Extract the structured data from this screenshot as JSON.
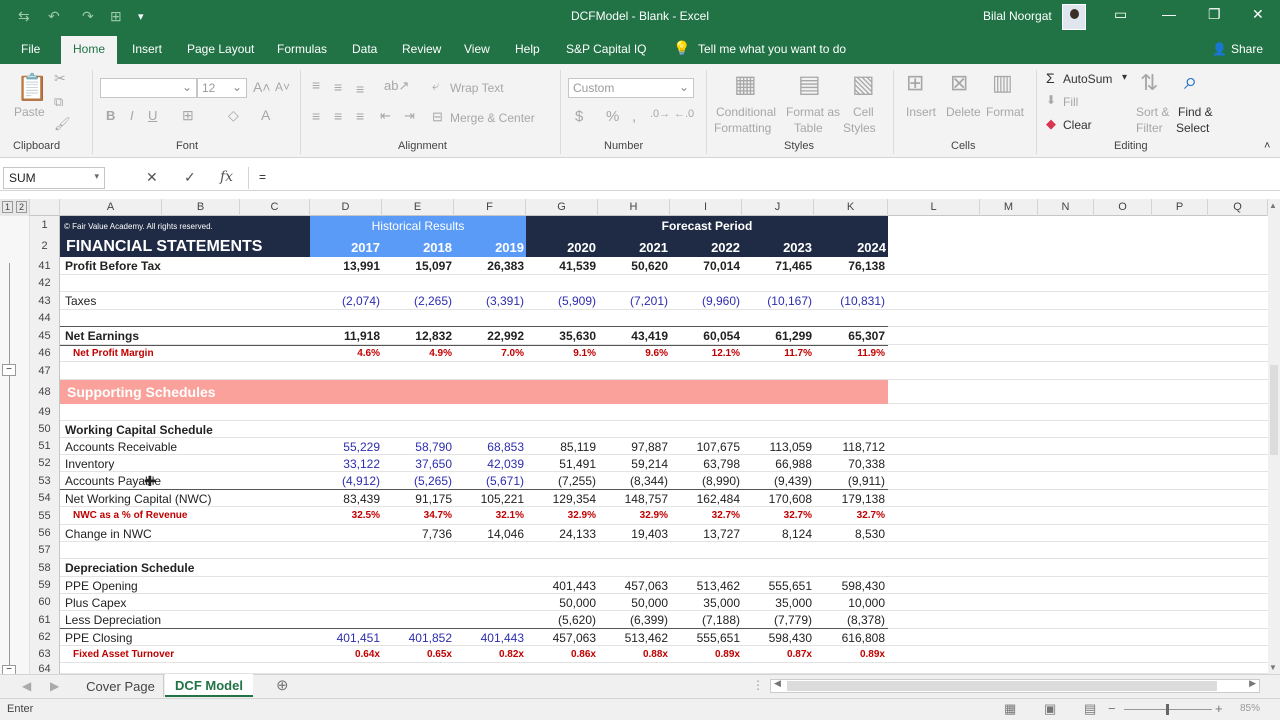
{
  "window": {
    "title": "DCFModel - Blank  -  Excel",
    "user": "Bilal Noorgat"
  },
  "menu_tabs": [
    "File",
    "Home",
    "Insert",
    "Page Layout",
    "Formulas",
    "Data",
    "Review",
    "View",
    "Help",
    "S&P Capital IQ"
  ],
  "tell_me": "Tell me what you want to do",
  "share": "Share",
  "ribbon": {
    "paste": "Paste",
    "clipboard": "Clipboard",
    "font": "Font",
    "font_size": "12",
    "alignment": "Alignment",
    "wrap_text": "Wrap Text",
    "merge_center": "Merge & Center",
    "number_format": "Custom",
    "number": "Number",
    "cond_fmt": [
      "Conditional",
      "Formatting"
    ],
    "format_table": [
      "Format as",
      "Table"
    ],
    "cell_styles": [
      "Cell",
      "Styles"
    ],
    "styles": "Styles",
    "insert": "Insert",
    "delete": "Delete",
    "format": "Format",
    "cells": "Cells",
    "autosum": "AutoSum",
    "fill": "Fill",
    "clear": "Clear",
    "sort_filter": [
      "Sort &",
      "Filter"
    ],
    "find_select": [
      "Find &",
      "Select"
    ],
    "editing": "Editing"
  },
  "formula_bar": {
    "name_box": "SUM",
    "formula": "="
  },
  "columns": [
    "A",
    "B",
    "C",
    "D",
    "E",
    "F",
    "G",
    "H",
    "I",
    "J",
    "K",
    "L",
    "M",
    "N",
    "O",
    "P",
    "Q"
  ],
  "outline_levels": [
    "1",
    "2"
  ],
  "header": {
    "copyright": "© Fair Value Academy. All rights reserved.",
    "title": "FINANCIAL STATEMENTS",
    "historical": "Historical Results",
    "forecast": "Forecast Period",
    "years": [
      "2017",
      "2018",
      "2019",
      "2020",
      "2021",
      "2022",
      "2023",
      "2024"
    ]
  },
  "rows": [
    {
      "num": "41",
      "label": "Profit Before Tax",
      "style": "bold",
      "values": [
        "13,991",
        "15,097",
        "26,383",
        "41,539",
        "50,620",
        "70,014",
        "71,465",
        "76,138"
      ]
    },
    {
      "num": "42",
      "label": "",
      "values": []
    },
    {
      "num": "43",
      "label": "Taxes",
      "style": "taxes",
      "values": [
        "(2,074)",
        "(2,265)",
        "(3,391)",
        "(5,909)",
        "(7,201)",
        "(9,960)",
        "(10,167)",
        "(10,831)"
      ]
    },
    {
      "num": "44",
      "label": "",
      "values": []
    },
    {
      "num": "45",
      "label": "Net Earnings",
      "style": "bold",
      "values": [
        "11,918",
        "12,832",
        "22,992",
        "35,630",
        "43,419",
        "60,054",
        "61,299",
        "65,307"
      ]
    },
    {
      "num": "46",
      "label": "Net Profit Margin",
      "style": "red",
      "values": [
        "4.6%",
        "4.9%",
        "7.0%",
        "9.1%",
        "9.6%",
        "12.1%",
        "11.7%",
        "11.9%"
      ]
    },
    {
      "num": "47",
      "label": "",
      "values": []
    },
    {
      "num": "48",
      "label": "Supporting Schedules",
      "style": "section",
      "values": []
    },
    {
      "num": "49",
      "label": "",
      "values": []
    },
    {
      "num": "50",
      "label": "Working Capital Schedule",
      "style": "heading",
      "values": []
    },
    {
      "num": "51",
      "label": "Accounts Receivable",
      "style": "hist-blue",
      "values": [
        "55,229",
        "58,790",
        "68,853",
        "85,119",
        "97,887",
        "107,675",
        "113,059",
        "118,712"
      ]
    },
    {
      "num": "52",
      "label": "Inventory",
      "style": "hist-blue",
      "values": [
        "33,122",
        "37,650",
        "42,039",
        "51,491",
        "59,214",
        "63,798",
        "66,988",
        "70,338"
      ]
    },
    {
      "num": "53",
      "label": "Accounts Payable",
      "style": "hist-blue",
      "values": [
        "(4,912)",
        "(5,265)",
        "(5,671)",
        "(7,255)",
        "(8,344)",
        "(8,990)",
        "(9,439)",
        "(9,911)"
      ]
    },
    {
      "num": "54",
      "label": "Net Working Capital (NWC)",
      "values": [
        "83,439",
        "91,175",
        "105,221",
        "129,354",
        "148,757",
        "162,484",
        "170,608",
        "179,138"
      ]
    },
    {
      "num": "55",
      "label": "NWC as a % of Revenue",
      "style": "red",
      "values": [
        "32.5%",
        "34.7%",
        "32.1%",
        "32.9%",
        "32.9%",
        "32.7%",
        "32.7%",
        "32.7%"
      ]
    },
    {
      "num": "56",
      "label": "Change in NWC",
      "values": [
        "",
        "7,736",
        "14,046",
        "24,133",
        "19,403",
        "13,727",
        "8,124",
        "8,530"
      ]
    },
    {
      "num": "57",
      "label": "",
      "values": []
    },
    {
      "num": "58",
      "label": "Depreciation Schedule",
      "style": "heading",
      "values": []
    },
    {
      "num": "59",
      "label": "PPE Opening",
      "values": [
        "",
        "",
        "",
        "401,443",
        "457,063",
        "513,462",
        "555,651",
        "598,430"
      ]
    },
    {
      "num": "60",
      "label": "Plus Capex",
      "values": [
        "",
        "",
        "",
        "50,000",
        "50,000",
        "35,000",
        "35,000",
        "10,000"
      ]
    },
    {
      "num": "61",
      "label": "Less Depreciation",
      "values": [
        "",
        "",
        "",
        "(5,620)",
        "(6,399)",
        "(7,188)",
        "(7,779)",
        "(8,378)"
      ]
    },
    {
      "num": "62",
      "label": "PPE Closing",
      "style": "hist-blue",
      "values": [
        "401,451",
        "401,852",
        "401,443",
        "457,063",
        "513,462",
        "555,651",
        "598,430",
        "616,808"
      ]
    },
    {
      "num": "63",
      "label": "Fixed Asset Turnover",
      "style": "red",
      "values": [
        "0.64x",
        "0.65x",
        "0.82x",
        "0.86x",
        "0.88x",
        "0.89x",
        "0.87x",
        "0.89x"
      ]
    },
    {
      "num": "64",
      "label": "",
      "values": []
    }
  ],
  "sheet_tabs": [
    "Cover Page",
    "DCF Model"
  ],
  "status": {
    "mode": "Enter",
    "zoom": "85%"
  },
  "colors": {
    "excel_green": "#217346",
    "header_navy": "#1f2a44",
    "historical_blue": "#5b9bf8",
    "section_salmon": "#f9a19a",
    "input_blue": "#2d2db0",
    "ratio_red": "#c00000"
  }
}
